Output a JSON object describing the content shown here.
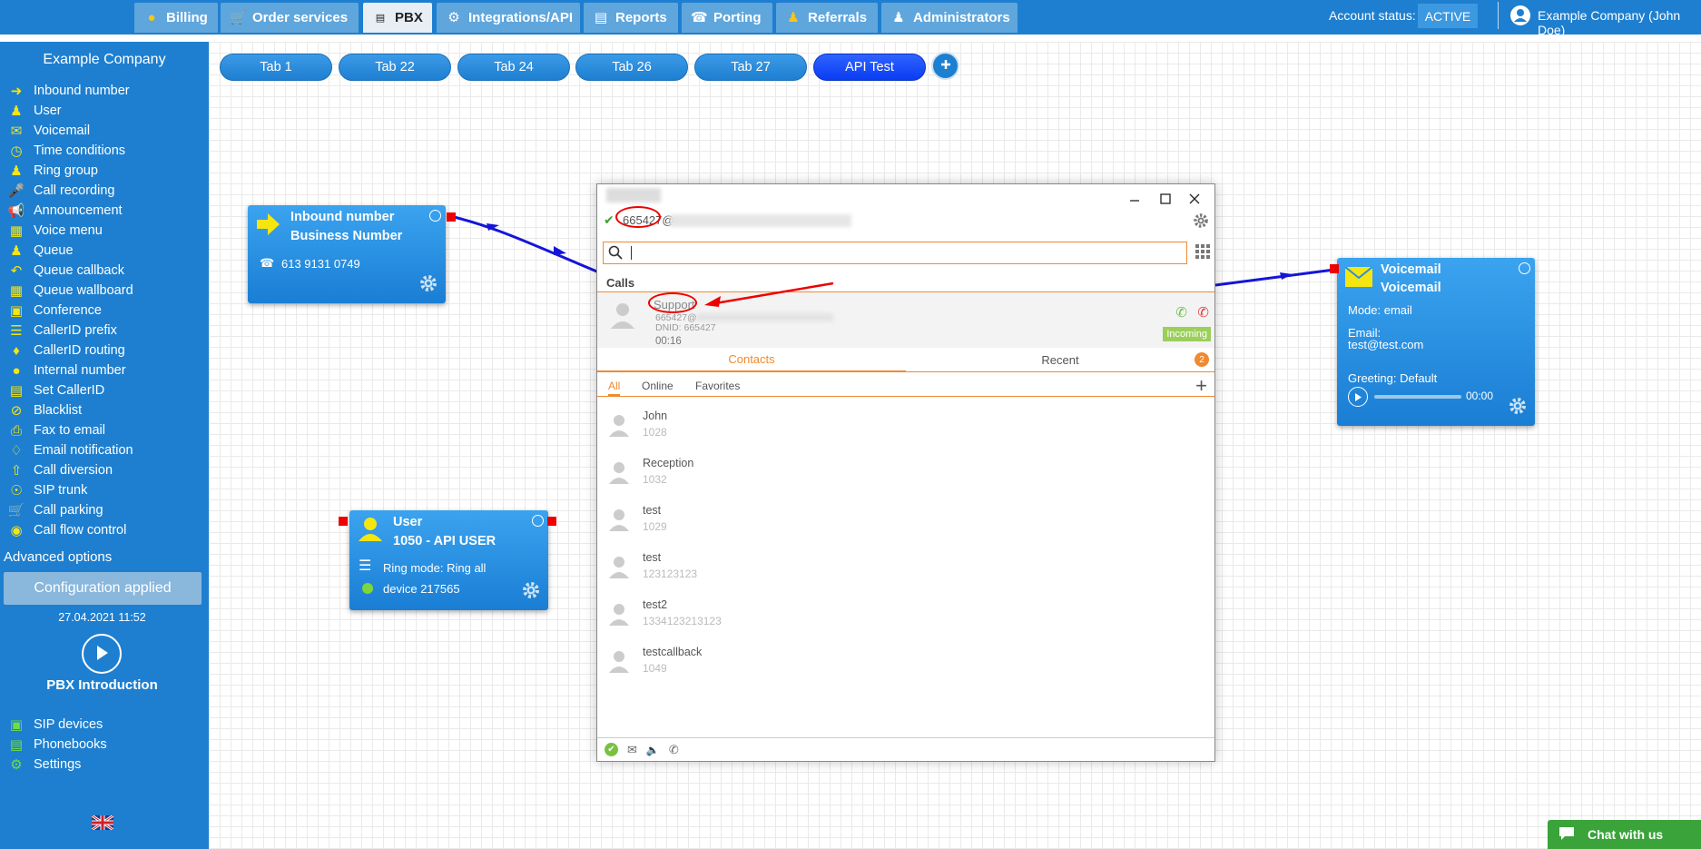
{
  "nav": {
    "tabs": [
      {
        "label": "Billing",
        "icon": "coins-icon"
      },
      {
        "label": "Order services",
        "icon": "cart-icon"
      },
      {
        "label": "PBX",
        "icon": "pbx-icon"
      },
      {
        "label": "Integrations/API",
        "icon": "gear-icon"
      },
      {
        "label": "Reports",
        "icon": "report-icon"
      },
      {
        "label": "Porting",
        "icon": "phone-icon"
      },
      {
        "label": "Referrals",
        "icon": "person-icon"
      },
      {
        "label": "Administrators",
        "icon": "admin-icon"
      }
    ],
    "active_tab": "PBX",
    "account_status_label": "Account status:",
    "account_status": "ACTIVE",
    "user_name": "Example Company (John Doe)"
  },
  "sidebar": {
    "company": "Example Company",
    "items": [
      "Inbound number",
      "User",
      "Voicemail",
      "Time conditions",
      "Ring group",
      "Call recording",
      "Announcement",
      "Voice menu",
      "Queue",
      "Queue callback",
      "Queue wallboard",
      "Conference",
      "CallerID prefix",
      "CallerID routing",
      "Internal number",
      "Set CallerID",
      "Blacklist",
      "Fax to email",
      "Email notification",
      "Call diversion",
      "SIP trunk",
      "Call parking",
      "Call flow control"
    ],
    "advanced_options": "Advanced options",
    "config_button": "Configuration applied",
    "config_date": "27.04.2021 11:52",
    "intro_label": "PBX Introduction",
    "bottom_items": [
      "SIP devices",
      "Phonebooks",
      "Settings"
    ]
  },
  "tabs": [
    "Tab 1",
    "Tab 22",
    "Tab 24",
    "Tab 26",
    "Tab 27",
    "API Test"
  ],
  "active_canvas_tab": "API Test",
  "nodes": {
    "inbound": {
      "title1": "Inbound number",
      "title2": "Business Number",
      "phone": "613 9131 0749"
    },
    "user": {
      "title1": "User",
      "title2": "1050 - API USER",
      "ring_mode": "Ring mode: Ring all",
      "device": "device 217565"
    },
    "voicemail": {
      "title1": "Voicemail",
      "title2": "Voicemail",
      "mode": "Mode: email",
      "email_label": "Email:",
      "email": "test@test.com",
      "greeting": "Greeting: Default",
      "duration": "00:00"
    }
  },
  "phone": {
    "extension": "665427@",
    "section_calls": "Calls",
    "call": {
      "name": "Support",
      "line1": "665427@",
      "dnid": "DNID: 665427",
      "duration": "00:16",
      "status": "Incoming"
    },
    "tabs": {
      "contacts": "Contacts",
      "recent": "Recent",
      "recent_badge": "2"
    },
    "filters": [
      "All",
      "Online",
      "Favorites"
    ],
    "contacts": [
      {
        "name": "John",
        "number": "1028"
      },
      {
        "name": "Reception",
        "number": "1032"
      },
      {
        "name": "test",
        "number": "1029"
      },
      {
        "name": "test",
        "number": "123123123"
      },
      {
        "name": "test2",
        "number": "1334123213123"
      },
      {
        "name": "testcallback",
        "number": "1049"
      }
    ]
  },
  "chat_label": "Chat with us"
}
